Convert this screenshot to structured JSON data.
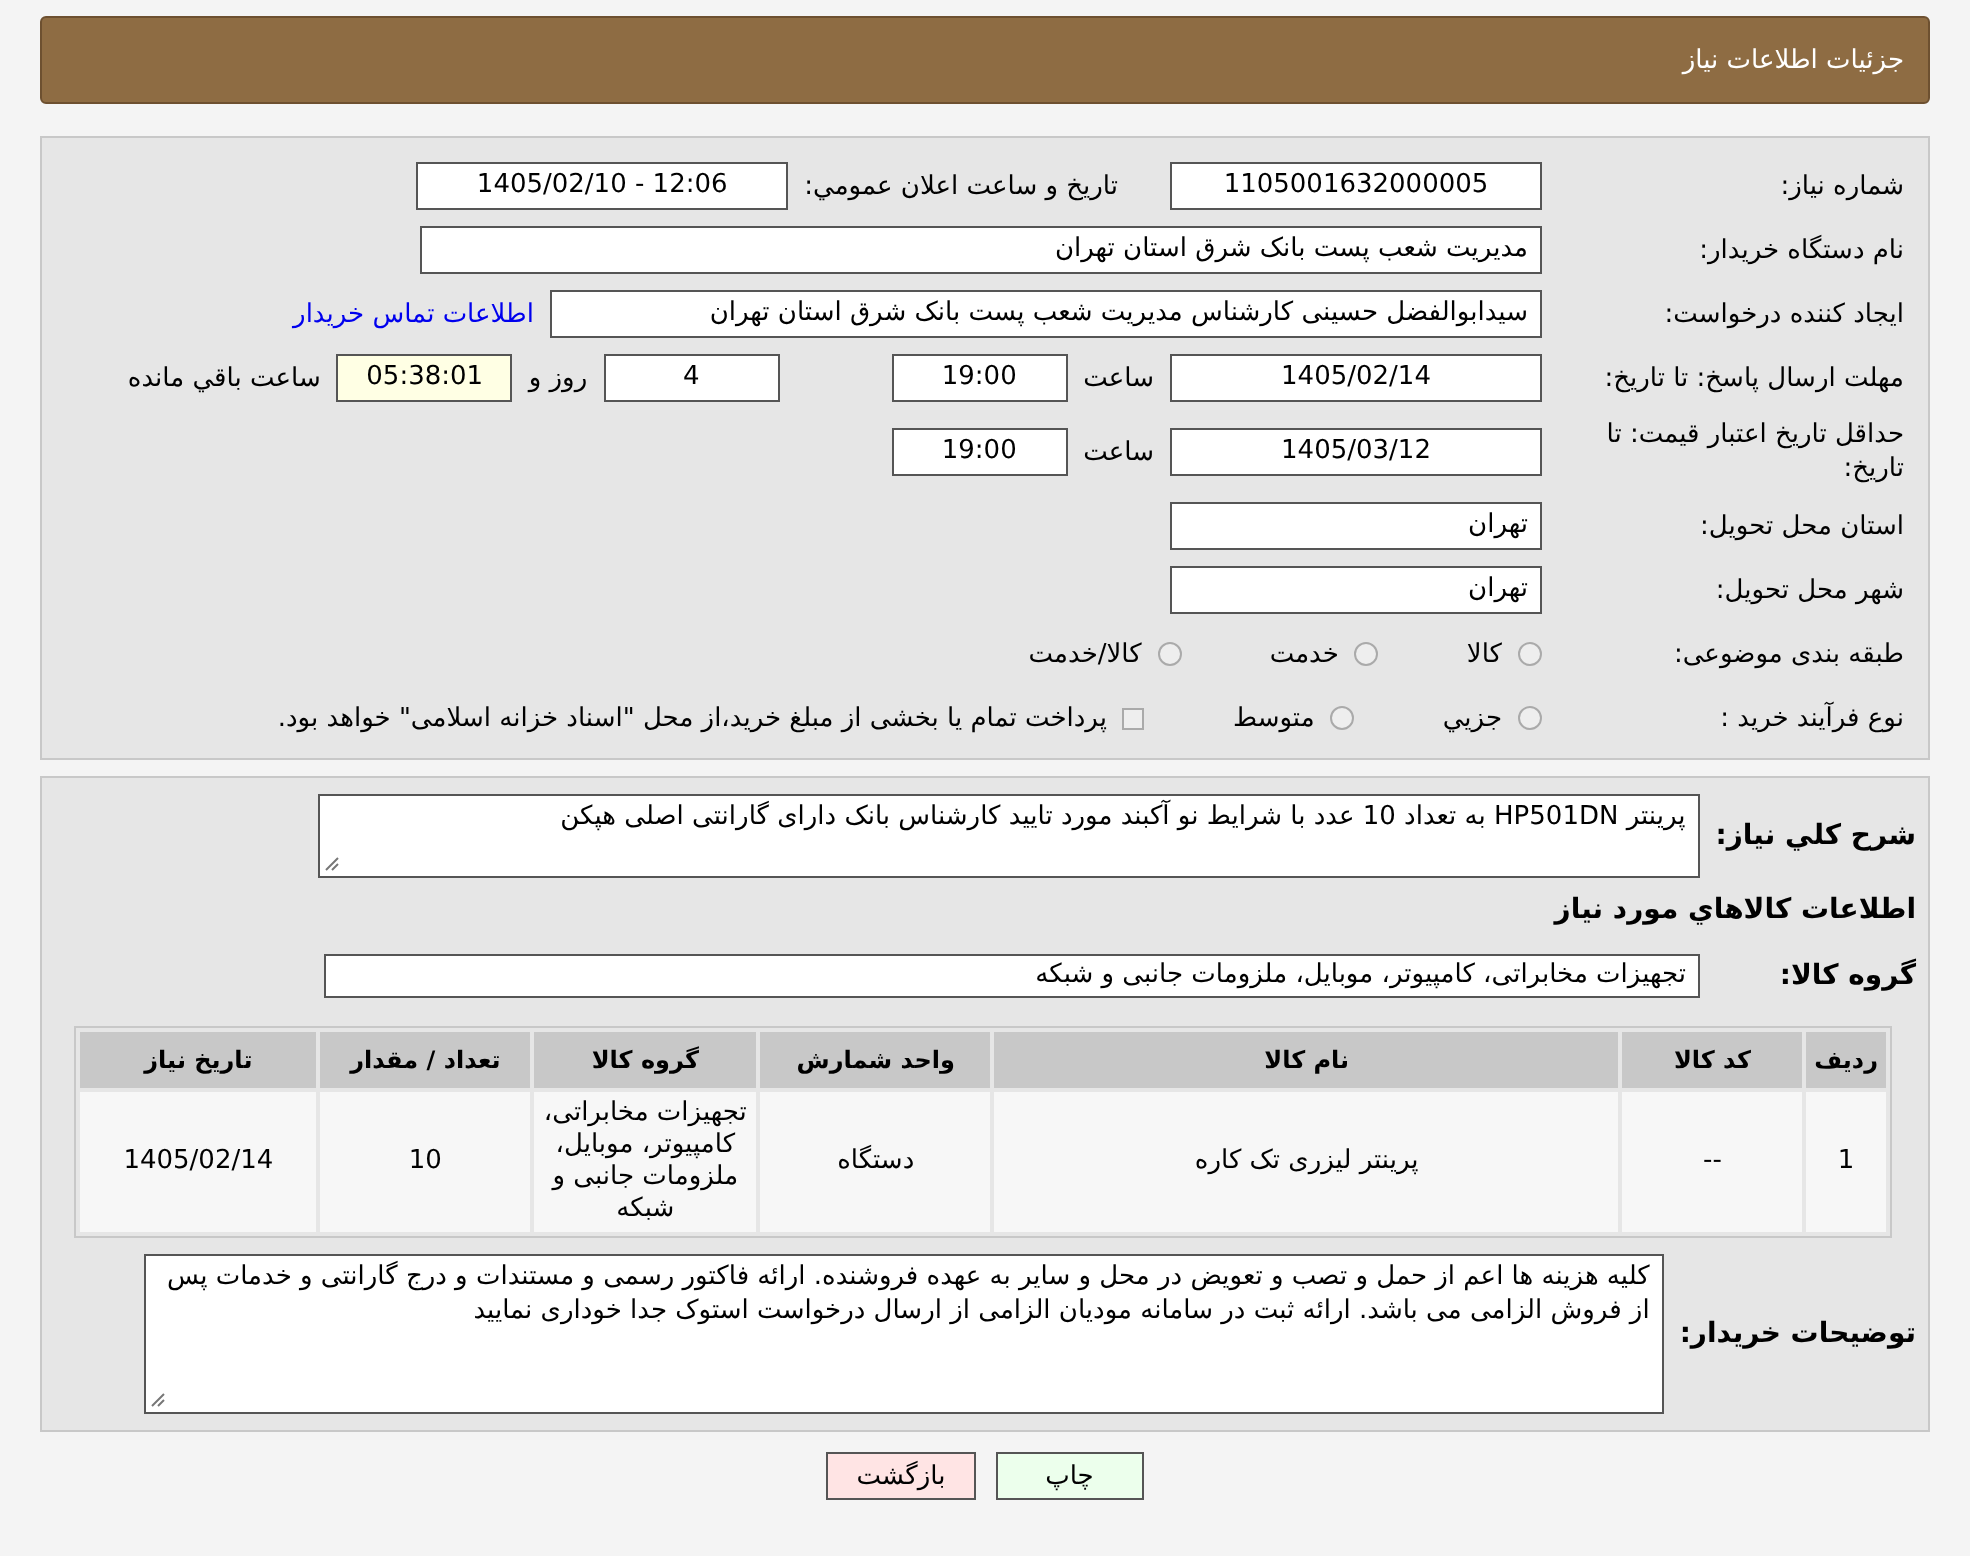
{
  "header": {
    "title": "جزئیات اطلاعات نیاز"
  },
  "details": {
    "request_number": {
      "label": "شماره نیاز:",
      "value": "1105001632000005"
    },
    "announcement": {
      "label": "تاریخ و ساعت اعلان عمومي:",
      "value": "1405/02/10 - 12:06"
    },
    "buyer_org": {
      "label": "نام دستگاه خریدار:",
      "value": "مدیریت شعب پست بانک شرق استان تهران"
    },
    "requester": {
      "label": "ایجاد کننده درخواست:",
      "value": "سیدابوالفضل حسینی کارشناس مدیریت شعب پست بانک شرق استان تهران",
      "link": "اطلاعات تماس خریدار"
    },
    "response_deadline": {
      "label": "مهلت ارسال پاسخ: تا تاریخ:",
      "date": "1405/02/14",
      "time_label": "ساعت",
      "time": "19:00",
      "days": "4",
      "days_label": "روز و",
      "remaining": "05:38:01",
      "remaining_label": "ساعت باقي مانده"
    },
    "price_validity": {
      "label": "حداقل تاریخ اعتبار قیمت: تا تاریخ:",
      "date": "1405/03/12",
      "time_label": "ساعت",
      "time": "19:00"
    },
    "delivery_province": {
      "label": "استان محل تحویل:",
      "value": "تهران"
    },
    "delivery_city": {
      "label": "شهر محل تحویل:",
      "value": "تهران"
    },
    "category": {
      "label": "طبقه بندی موضوعی:",
      "options": [
        {
          "label": "کالا",
          "selected": false
        },
        {
          "label": "خدمت",
          "selected": false
        },
        {
          "label": "کالا/خدمت",
          "selected": false
        }
      ]
    },
    "purchase_type": {
      "label": "نوع فرآیند خرید :",
      "options": [
        {
          "label": "جزيي",
          "selected": false
        },
        {
          "label": "متوسط",
          "selected": false
        }
      ],
      "payment_note": {
        "text": "پرداخت تمام یا بخشی از مبلغ خرید،از محل \"اسناد خزانه اسلامی\" خواهد بود.",
        "checked": false
      }
    }
  },
  "description": {
    "label": "شرح کلي نیاز:",
    "value": "پرینتر HP501DN به تعداد 10 عدد با شرایط نو آکبند مورد تایید کارشناس بانک دارای گارانتی اصلی هپکن"
  },
  "goods": {
    "heading": "اطلاعات کالاهاي مورد نیاز",
    "group_label": "گروه کالا:",
    "group_value": "تجهیزات مخابراتی، کامپیوتر، موبایل، ملزومات جانبی و شبکه",
    "table": {
      "columns": [
        "ردیف",
        "کد کالا",
        "نام کالا",
        "واحد شمارش",
        "گروه کالا",
        "تعداد / مقدار",
        "تاریخ نیاز"
      ],
      "rows": [
        [
          "1",
          "--",
          "پرینتر لیزری تک کاره",
          "دستگاه",
          "تجهیزات مخابراتی، کامپیوتر، موبایل، ملزومات جانبی و شبکه",
          "10",
          "1405/02/14"
        ]
      ]
    }
  },
  "buyer_notes": {
    "label": "توضیحات خریدار:",
    "value": "کلیه  هزینه ها اعم از حمل و تصب و تعویض در محل  و سایر به عهده فروشنده. ارائه فاکتور رسمی و مستندات و درج گارانتی و خدمات پس از فروش الزامی می باشد. ارائه ثبت در سامانه مودیان الزامی از ارسال درخواست  استوک جدا خوداری نمایید"
  },
  "buttons": [
    {
      "kind": "print",
      "label": "چاپ"
    },
    {
      "kind": "back",
      "label": "بازگشت"
    }
  ]
}
